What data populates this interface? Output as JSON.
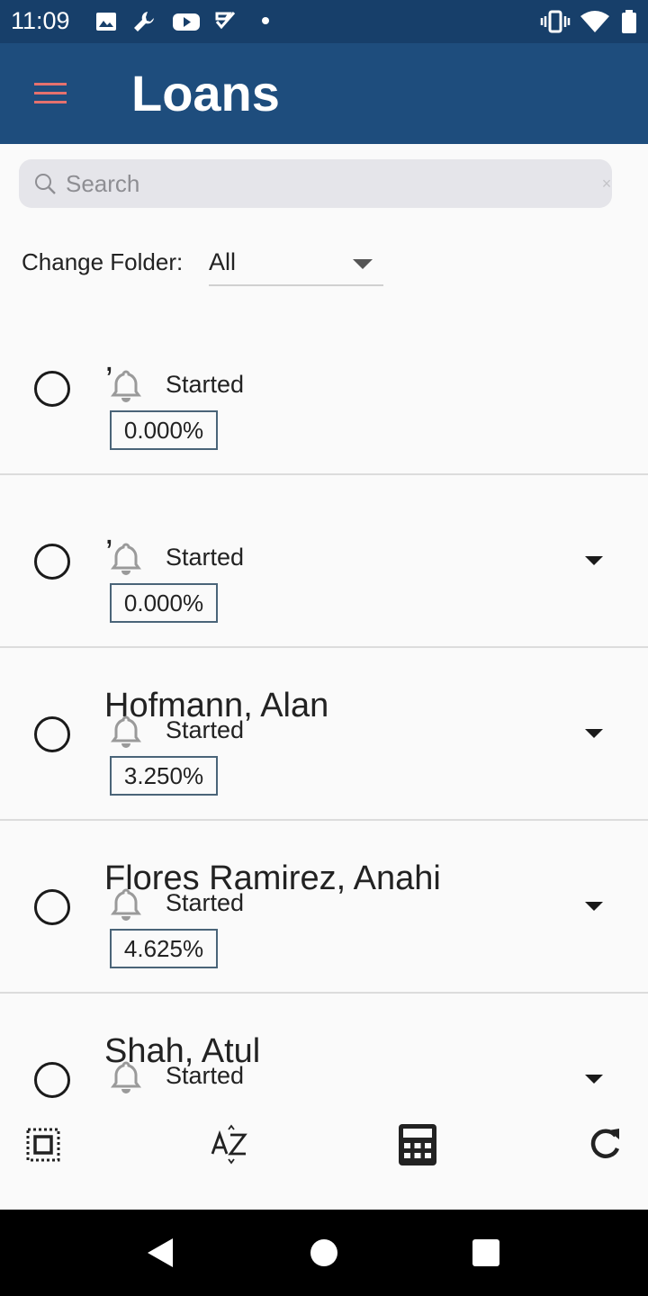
{
  "status_bar": {
    "time": "11:09",
    "icons_left": [
      "image-icon",
      "wrench-icon",
      "youtube-icon",
      "check-icon",
      "dot-icon"
    ],
    "icons_right": [
      "vibrate-icon",
      "wifi-icon",
      "battery-icon"
    ]
  },
  "app_bar": {
    "title": "Loans",
    "menu_icon": "hamburger-menu-icon",
    "accent": "#e5716e",
    "background": "#1e4d7d"
  },
  "search": {
    "placeholder": "Search",
    "value": "",
    "clear_icon": "×"
  },
  "folder": {
    "label": "Change Folder:",
    "selected": "All"
  },
  "loans": [
    {
      "name": ",",
      "status": "Started",
      "rate": "0.000%",
      "expandable": false
    },
    {
      "name": ",",
      "status": "Started",
      "rate": "0.000%",
      "expandable": true
    },
    {
      "name": "Hofmann, Alan",
      "status": "Started",
      "rate": "3.250%",
      "expandable": true
    },
    {
      "name": "Flores Ramirez, Anahi",
      "status": "Started",
      "rate": "4.625%",
      "expandable": true
    },
    {
      "name": "Shah, Atul",
      "status": "Started",
      "rate": "",
      "expandable": true
    }
  ],
  "toolbar": {
    "buttons": [
      "select-all-icon",
      "sort-az-icon",
      "calculator-icon",
      "refresh-icon"
    ]
  },
  "nav_bar": {
    "buttons": [
      "back-icon",
      "home-icon",
      "recents-icon"
    ]
  }
}
